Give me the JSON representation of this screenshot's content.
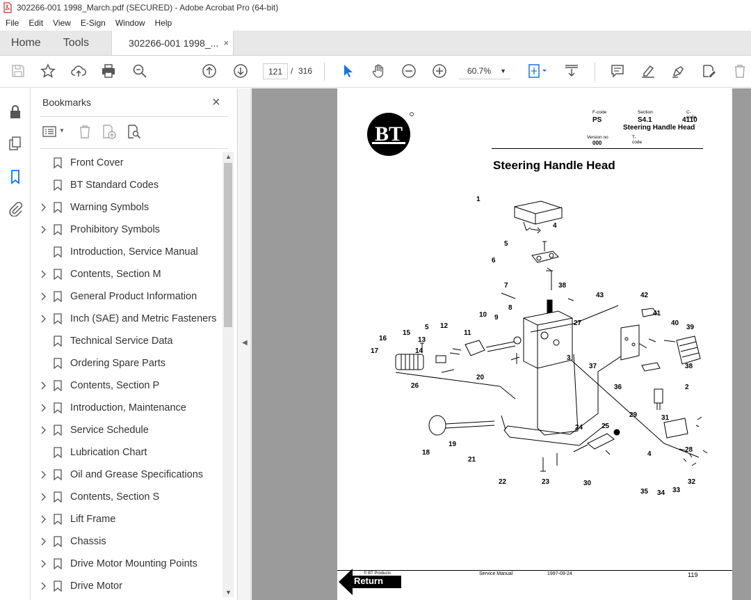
{
  "window": {
    "title": "302266-001 1998_March.pdf (SECURED) - Adobe Acrobat Pro (64-bit)"
  },
  "menu": [
    "File",
    "Edit",
    "View",
    "E-Sign",
    "Window",
    "Help"
  ],
  "tabs": {
    "home": "Home",
    "tools": "Tools",
    "document": "302266-001 1998_...",
    "close": "×"
  },
  "toolbar": {
    "current_page": "121",
    "separator": "/",
    "total_pages": "316",
    "zoom": "60.7%"
  },
  "bookmarks": {
    "title": "Bookmarks",
    "close": "×",
    "items": [
      {
        "label": "Front Cover",
        "expandable": false
      },
      {
        "label": "BT Standard Codes",
        "expandable": false
      },
      {
        "label": "Warning Symbols",
        "expandable": true
      },
      {
        "label": "Prohibitory Symbols",
        "expandable": true
      },
      {
        "label": "Introduction, Service Manual",
        "expandable": false
      },
      {
        "label": "Contents, Section M",
        "expandable": true
      },
      {
        "label": "General Product Information",
        "expandable": true
      },
      {
        "label": "Inch (SAE) and Metric Fasteners",
        "expandable": true
      },
      {
        "label": "Technical Service Data",
        "expandable": false
      },
      {
        "label": "Ordering Spare Parts",
        "expandable": false
      },
      {
        "label": "Contents, Section P",
        "expandable": true
      },
      {
        "label": "Introduction, Maintenance",
        "expandable": true
      },
      {
        "label": "Service Schedule",
        "expandable": true
      },
      {
        "label": "Lubrication Chart",
        "expandable": false
      },
      {
        "label": "Oil and Grease Specifications",
        "expandable": true
      },
      {
        "label": "Contents, Section S",
        "expandable": true
      },
      {
        "label": "Lift Frame",
        "expandable": true
      },
      {
        "label": "Chassis",
        "expandable": true
      },
      {
        "label": "Drive Motor Mounting Points",
        "expandable": true
      },
      {
        "label": "Drive Motor",
        "expandable": true
      }
    ]
  },
  "page": {
    "logo": "BT",
    "header": {
      "fcode_label": "F-code",
      "fcode": "PS",
      "section_label": "Section",
      "section": "S4.1",
      "section_name": "Steering Handle Head",
      "ccode_label": "C-code",
      "ccode": "4110",
      "version_label": "Version no",
      "version": "000",
      "tcode_label": "T-code"
    },
    "title": "Steering Handle Head",
    "callouts": [
      "1",
      "4",
      "5",
      "6",
      "7",
      "8",
      "38",
      "43",
      "42",
      "41",
      "40",
      "39",
      "27",
      "3",
      "37",
      "36",
      "2",
      "10",
      "9",
      "11",
      "12",
      "5",
      "13",
      "14",
      "15",
      "16",
      "17",
      "26",
      "20",
      "29",
      "31",
      "28",
      "24",
      "25",
      "4",
      "18",
      "19",
      "21",
      "22",
      "23",
      "30",
      "35",
      "34",
      "33",
      "32",
      "38"
    ],
    "footer": {
      "copyright": "© BT Products",
      "manual": "Service Manual",
      "date": "1997-09-24",
      "page_no": "119",
      "return": "Return"
    }
  }
}
